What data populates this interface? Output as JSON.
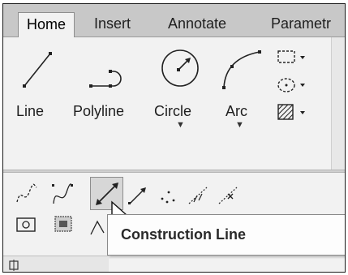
{
  "tabs": [
    "Home",
    "Insert",
    "Annotate",
    "Parametr"
  ],
  "draw_tools": [
    {
      "label": "Line",
      "icon": "line-icon",
      "has_dropdown": false
    },
    {
      "label": "Polyline",
      "icon": "polyline-icon",
      "has_dropdown": false
    },
    {
      "label": "Circle",
      "icon": "circle-icon",
      "has_dropdown": true
    },
    {
      "label": "Arc",
      "icon": "arc-icon",
      "has_dropdown": true
    }
  ],
  "small_tools": [
    "rectangle-icon",
    "ellipse-icon",
    "hatch-icon"
  ],
  "expanded_row1": [
    "spline-fit-icon",
    "spline-cv-icon",
    "construction-line-icon",
    "ray-icon",
    "multiple-points-icon",
    "divide-icon",
    "measure-icon"
  ],
  "expanded_row2": [
    "region-icon",
    "wipeout-icon",
    "3d-polyline-icon",
    "helix-icon",
    "donut-icon",
    "revision-cloud-icon"
  ],
  "tooltip": {
    "title": "Construction Line"
  },
  "colors": {
    "tab_bar": "#c8c8c8",
    "panel": "#f2f2f2",
    "highlight": "#d7d7d7"
  }
}
